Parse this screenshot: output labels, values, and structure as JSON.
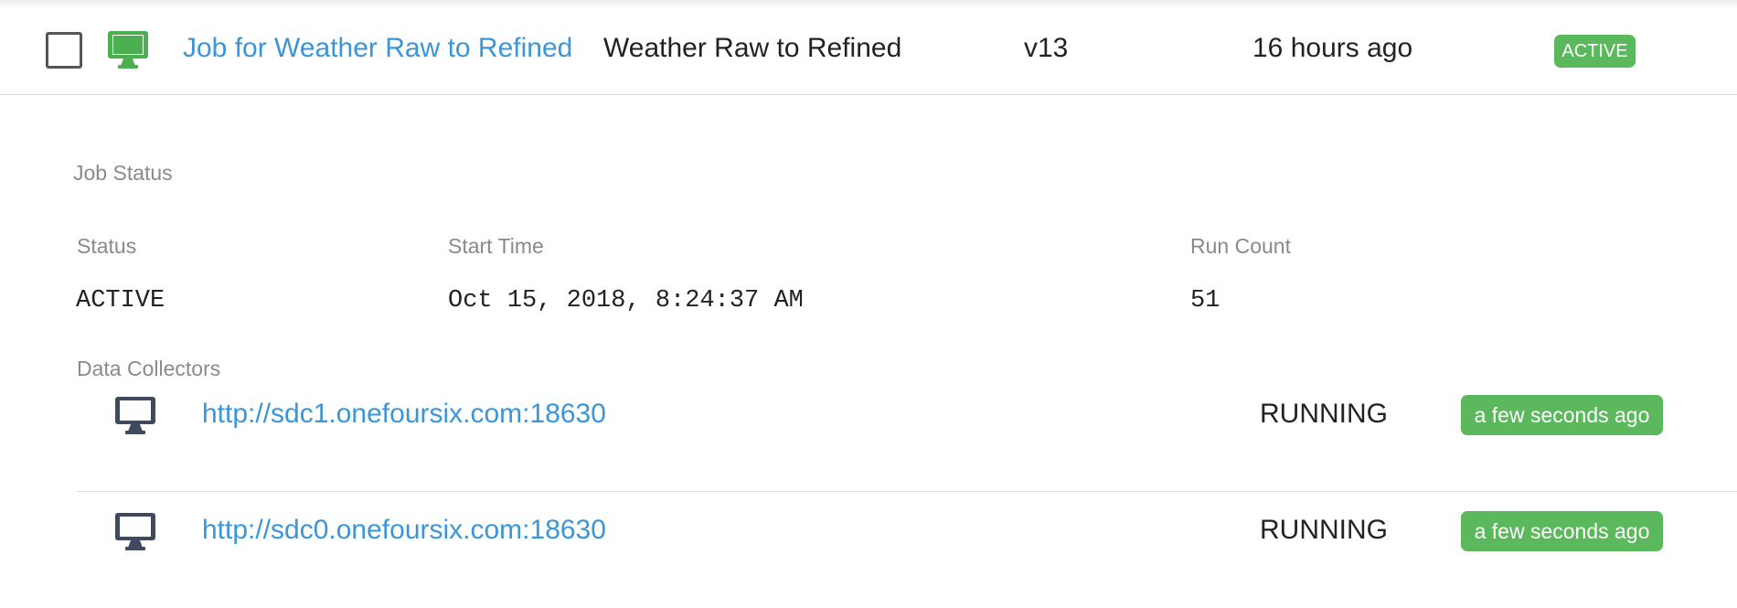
{
  "job": {
    "name": "Job for Weather Raw to Refined",
    "pipeline": "Weather Raw to Refined",
    "version": "v13",
    "last_modified": "16 hours ago",
    "status_badge": "ACTIVE"
  },
  "job_status": {
    "section_title": "Job Status",
    "status_label": "Status",
    "status_value": "ACTIVE",
    "start_time_label": "Start Time",
    "start_time_value": "Oct 15, 2018, 8:24:37 AM",
    "run_count_label": "Run Count",
    "run_count_value": "51"
  },
  "data_collectors": {
    "title": "Data Collectors",
    "items": [
      {
        "url": "http://sdc1.onefoursix.com:18630",
        "status": "RUNNING",
        "last_seen": "a few seconds ago"
      },
      {
        "url": "http://sdc0.onefoursix.com:18630",
        "status": "RUNNING",
        "last_seen": "a few seconds ago"
      }
    ]
  },
  "colors": {
    "link": "#3b95d9",
    "badge_green": "#5cb85c",
    "job_icon": "#4caf50",
    "collector_icon": "#3f4a5e",
    "muted_label": "#8a8a8a"
  },
  "icons": {
    "job": "desktop-monitor-icon",
    "collector": "desktop-monitor-icon"
  }
}
